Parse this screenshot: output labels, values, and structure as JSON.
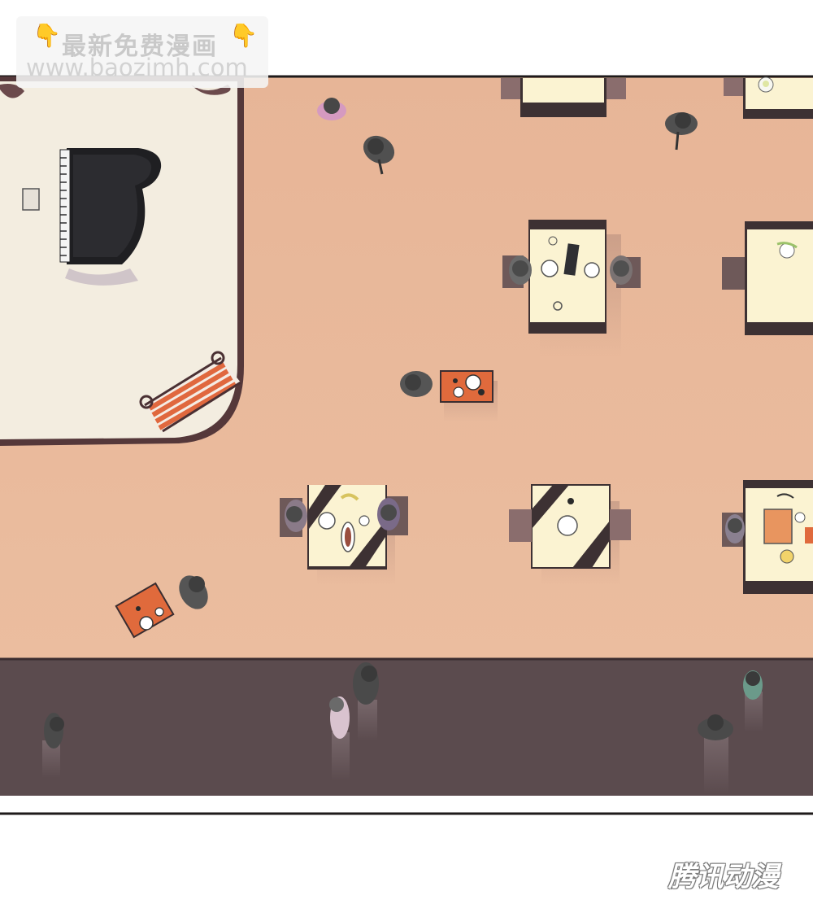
{
  "watermark": {
    "title": "最新免费漫画",
    "url": "www.baozimh.com",
    "hand_icon": "pointing-down-hand-icon"
  },
  "brand": {
    "logo_text": "腾讯动漫"
  },
  "palette": {
    "floor": "#e9b89a",
    "stage": "#f3ede0",
    "stage_edge": "#55383a",
    "walkway": "#5b4b4e",
    "table_top": "#fbf3d2",
    "chair": "#8a6d6d",
    "tray": "#e06a3c",
    "person": "#4f4f4f"
  },
  "scene": {
    "description_icons": [
      "grand-piano-icon",
      "stage-stairs-icon",
      "dining-table-icon",
      "chair-icon",
      "waiter-with-cart-icon",
      "pedestrian-icon"
    ]
  }
}
